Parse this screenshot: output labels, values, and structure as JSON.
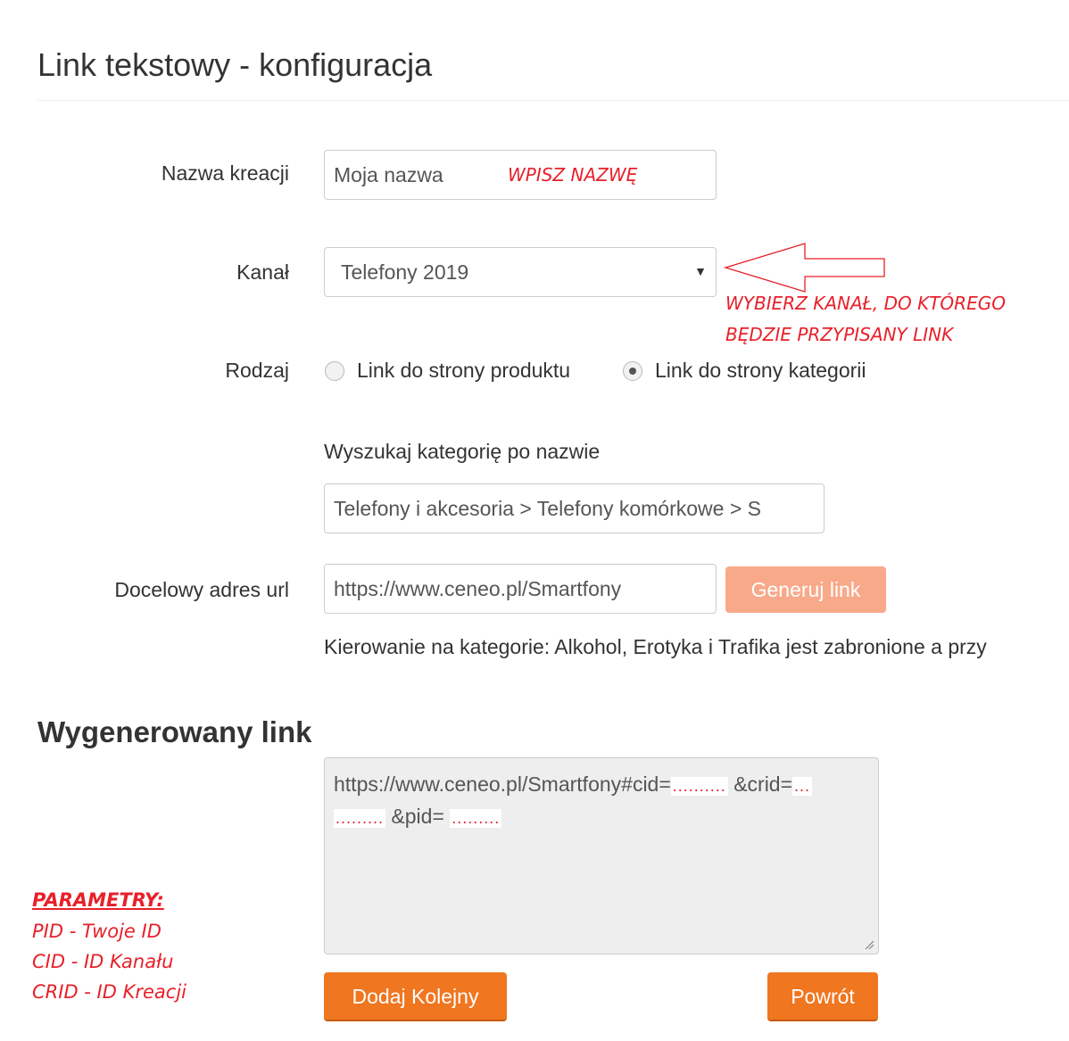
{
  "page": {
    "title": "Link tekstowy - konfiguracja"
  },
  "form": {
    "name": {
      "label": "Nazwa kreacji",
      "value": "Moja nazwa",
      "annotation": "WPISZ NAZWĘ"
    },
    "channel": {
      "label": "Kanał",
      "selected": "Telefony 2019",
      "annotation_line1": "WYBIERZ KANAŁ, DO KTÓREGO",
      "annotation_line2": "BĘDZIE PRZYPISANY LINK"
    },
    "type": {
      "label": "Rodzaj",
      "options": [
        {
          "label": "Link do strony produktu",
          "checked": false
        },
        {
          "label": "Link do strony kategorii",
          "checked": true
        }
      ]
    },
    "category_search": {
      "label": "Wyszukaj kategorię po nazwie",
      "value": "Telefony i akcesoria > Telefony komórkowe > S"
    },
    "target_url": {
      "label": "Docelowy adres url",
      "value": "https://www.ceneo.pl/Smartfony",
      "button_label": "Generuj link",
      "note": "Kierowanie na kategorie: Alkohol, Erotyka i Trafika jest zabronione a przy"
    }
  },
  "generated": {
    "title": "Wygenerowany link",
    "line1_prefix": "https://www.ceneo.pl/Smartfony#cid=",
    "dots_cid": "..........",
    "crid_label": "&crid=",
    "dots_crid_a": "...",
    "dots_crid_b": ".........",
    "pid_label": "&pid=",
    "dots_pid": ".........",
    "add_button": "Dodaj Kolejny",
    "back_button": "Powrót"
  },
  "params": {
    "heading": "PARAMETRY:",
    "lines": [
      "PID - Twoje ID",
      "CID - ID Kanału",
      "CRID - ID Kreacji"
    ]
  },
  "colors": {
    "accent": "#f07620",
    "accent_light": "#f8a98a",
    "annotation": "#e8202a"
  }
}
